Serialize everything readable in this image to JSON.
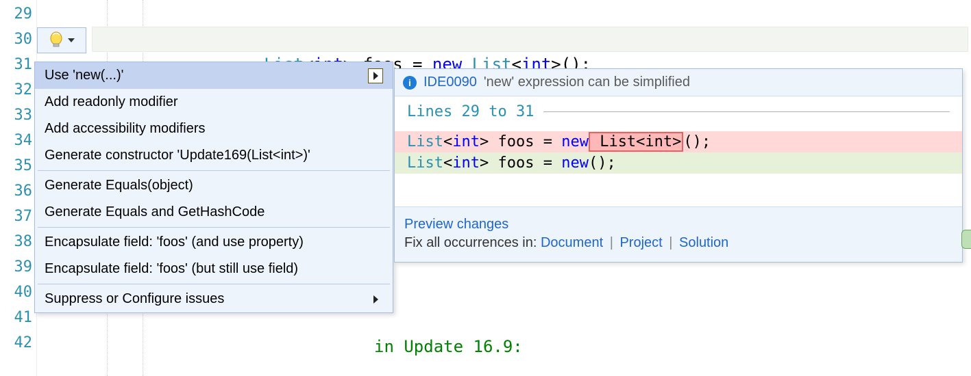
{
  "gutter": {
    "start": 29,
    "end": 42
  },
  "code_line": {
    "type1": "List",
    "lt1": "<",
    "kw_int1": "int",
    "gt1": ">",
    "ident": " foos ",
    "eq": "= ",
    "kw_new": "new",
    "sp": " ",
    "type2": "List",
    "lt2": "<",
    "kw_int2": "int",
    "gt2": ">",
    "tail": "();"
  },
  "menu": {
    "items": [
      {
        "label": "Use 'new(...)'",
        "selected": true,
        "submenu": true,
        "boxed": true
      },
      {
        "label": "Add readonly modifier"
      },
      {
        "label": "Add accessibility modifiers"
      },
      {
        "label": "Generate constructor 'Update169(List<int>)'"
      },
      {
        "sep": true
      },
      {
        "label": "Generate Equals(object)"
      },
      {
        "label": "Generate Equals and GetHashCode"
      },
      {
        "sep": true
      },
      {
        "label": "Encapsulate field: 'foos' (and use property)"
      },
      {
        "label": "Encapsulate field: 'foos' (but still use field)"
      },
      {
        "sep": true
      },
      {
        "label": "Suppress or Configure issues",
        "submenu": true
      }
    ]
  },
  "preview": {
    "code": "IDE0090",
    "message": "'new' expression can be simplified",
    "lines_label": "Lines 29 to 31",
    "diff": {
      "del": {
        "type1": "List",
        "lt1": "<",
        "kw_int1": "int",
        "gt1": ">",
        "mid": " foos = ",
        "kw_new": "new",
        "removed": " List<int>",
        "tail": "();"
      },
      "add": {
        "type1": "List",
        "lt1": "<",
        "kw_int1": "int",
        "gt1": ">",
        "mid": " foos = ",
        "kw_new": "new",
        "tail": "();"
      }
    },
    "footer": {
      "preview_link": "Preview changes",
      "fix_label": "Fix all occurrences in:",
      "scope_document": "Document",
      "scope_project": "Project",
      "scope_solution": "Solution"
    }
  },
  "bottom_comment": "in Update 16.9:"
}
